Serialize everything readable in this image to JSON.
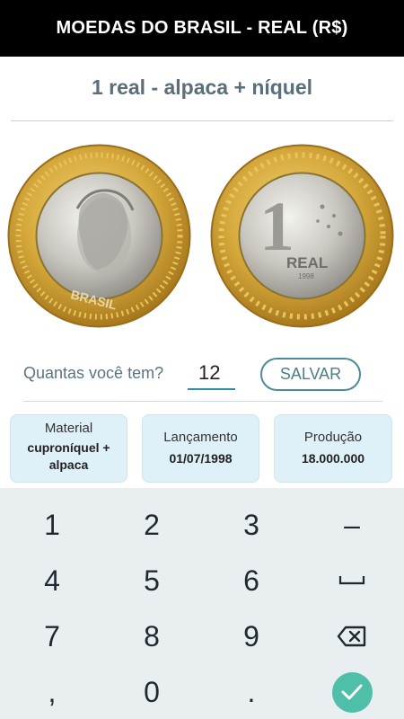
{
  "app": {
    "title": "MOEDAS DO BRASIL - REAL (R$)"
  },
  "coin": {
    "subtitle": "1 real -  alpaca + níquel",
    "obverse_inscription": "BRASIL",
    "reverse_denomination": "1",
    "reverse_text": "REAL",
    "reverse_year": "1998"
  },
  "quantity": {
    "label": "Quantas você tem?",
    "value": "12",
    "save_label": "SALVAR"
  },
  "info_cards": [
    {
      "label": "Material",
      "value": "cuproníquel + alpaca"
    },
    {
      "label": "Lançamento",
      "value": "01/07/1998"
    },
    {
      "label": "Produção",
      "value": "18.000.000"
    }
  ],
  "keyboard": {
    "keys": [
      "1",
      "2",
      "3",
      "4",
      "5",
      "6",
      "7",
      "8",
      "9",
      ",",
      "0",
      "."
    ],
    "minus": "–",
    "icons": {
      "space": "space-bar-icon",
      "backspace": "backspace-icon",
      "done": "checkmark-icon"
    },
    "colors": {
      "background": "#e9eef1",
      "done_button": "#4fbfaa"
    }
  },
  "colors": {
    "appbar": "#000000",
    "accent": "#2a8fa0",
    "card_background": "#dff1f8",
    "subtitle": "#5a6f7a"
  }
}
